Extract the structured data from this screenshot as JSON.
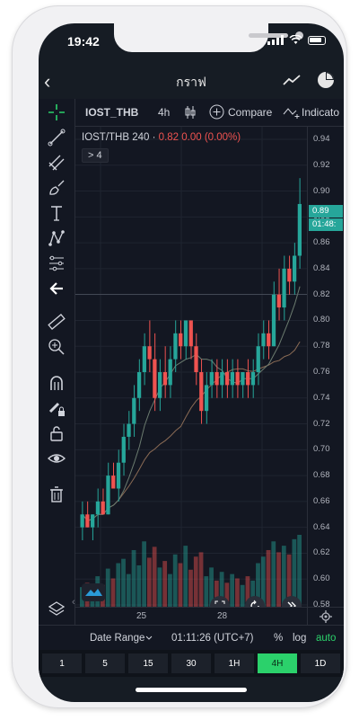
{
  "status": {
    "time": "19:42"
  },
  "nav": {
    "title": "กราฟ"
  },
  "toolbar": {
    "symbol": "IOST_THB",
    "interval": "4h",
    "compare": "Compare",
    "indicators": "Indicato"
  },
  "legend": {
    "pair": "IOST/THB",
    "period": "240",
    "sep": "·",
    "value": "0.82",
    "change": "0.00 (0.00%)",
    "collapsed": "> 4"
  },
  "price_axis": {
    "ticks": [
      "0.94",
      "0.92",
      "0.90",
      "0.88",
      "0.86",
      "0.84",
      "0.82",
      "0.80",
      "0.78",
      "0.76",
      "0.74",
      "0.72",
      "0.70",
      "0.68",
      "0.66",
      "0.64",
      "0.62",
      "0.60",
      "0.58"
    ],
    "last_price": "0.89",
    "countdown": "01:48:"
  },
  "time_axis": {
    "labels": [
      "25",
      "28"
    ]
  },
  "bottom": {
    "date_range": "Date Range",
    "clock": "01:11:26 (UTC+7)",
    "percent": "%",
    "log": "log",
    "auto": "auto"
  },
  "timeframes": [
    "1",
    "5",
    "15",
    "30",
    "1H",
    "4H",
    "1D"
  ],
  "active_timeframe": "4H",
  "colors": {
    "up": "#26a69a",
    "down": "#ef5350",
    "accent": "#2bd16b",
    "bg": "#131722"
  },
  "chart_data": {
    "type": "candlestick",
    "ylim": [
      0.58,
      0.94
    ],
    "x_ticks": [
      "25",
      "28"
    ],
    "series": [
      {
        "values": [
          [
            0.64,
            0.66,
            0.63,
            0.65
          ],
          [
            0.65,
            0.66,
            0.64,
            0.64
          ],
          [
            0.64,
            0.65,
            0.63,
            0.65
          ],
          [
            0.65,
            0.67,
            0.64,
            0.66
          ],
          [
            0.66,
            0.67,
            0.65,
            0.65
          ],
          [
            0.65,
            0.69,
            0.65,
            0.68
          ],
          [
            0.68,
            0.69,
            0.67,
            0.67
          ],
          [
            0.67,
            0.7,
            0.66,
            0.69
          ],
          [
            0.69,
            0.72,
            0.68,
            0.71
          ],
          [
            0.71,
            0.73,
            0.7,
            0.72
          ],
          [
            0.72,
            0.75,
            0.71,
            0.74
          ],
          [
            0.74,
            0.77,
            0.73,
            0.76
          ],
          [
            0.76,
            0.79,
            0.75,
            0.78
          ],
          [
            0.78,
            0.8,
            0.76,
            0.77
          ],
          [
            0.77,
            0.79,
            0.73,
            0.74
          ],
          [
            0.74,
            0.77,
            0.73,
            0.76
          ],
          [
            0.76,
            0.78,
            0.74,
            0.75
          ],
          [
            0.75,
            0.78,
            0.74,
            0.77
          ],
          [
            0.77,
            0.8,
            0.76,
            0.79
          ],
          [
            0.79,
            0.8,
            0.77,
            0.78
          ],
          [
            0.78,
            0.8,
            0.77,
            0.8
          ],
          [
            0.8,
            0.8,
            0.77,
            0.78
          ],
          [
            0.78,
            0.79,
            0.75,
            0.76
          ],
          [
            0.76,
            0.77,
            0.72,
            0.73
          ],
          [
            0.73,
            0.76,
            0.72,
            0.75
          ],
          [
            0.75,
            0.77,
            0.74,
            0.76
          ],
          [
            0.76,
            0.77,
            0.74,
            0.75
          ],
          [
            0.75,
            0.77,
            0.74,
            0.76
          ],
          [
            0.76,
            0.77,
            0.74,
            0.75
          ],
          [
            0.75,
            0.77,
            0.74,
            0.76
          ],
          [
            0.76,
            0.77,
            0.74,
            0.75
          ],
          [
            0.75,
            0.76,
            0.74,
            0.76
          ],
          [
            0.76,
            0.77,
            0.74,
            0.75
          ],
          [
            0.75,
            0.77,
            0.74,
            0.76
          ],
          [
            0.76,
            0.79,
            0.75,
            0.78
          ],
          [
            0.78,
            0.8,
            0.77,
            0.79
          ],
          [
            0.79,
            0.8,
            0.77,
            0.78
          ],
          [
            0.78,
            0.83,
            0.78,
            0.82
          ],
          [
            0.82,
            0.84,
            0.8,
            0.81
          ],
          [
            0.81,
            0.85,
            0.8,
            0.84
          ],
          [
            0.84,
            0.85,
            0.82,
            0.83
          ],
          [
            0.83,
            0.86,
            0.82,
            0.85
          ],
          [
            0.85,
            0.91,
            0.84,
            0.89
          ]
        ]
      }
    ],
    "volume": [
      18,
      22,
      14,
      28,
      20,
      35,
      26,
      40,
      44,
      30,
      52,
      38,
      60,
      45,
      55,
      36,
      42,
      30,
      48,
      40,
      56,
      34,
      46,
      50,
      28,
      36,
      24,
      32,
      22,
      30,
      26,
      20,
      28,
      24,
      40,
      46,
      52,
      60,
      50,
      56,
      48,
      62,
      66
    ]
  }
}
